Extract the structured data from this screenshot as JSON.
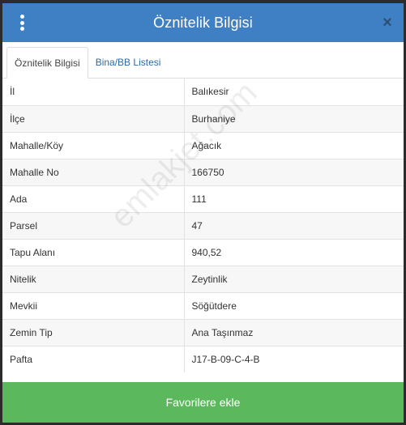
{
  "header": {
    "title": "Öznitelik Bilgisi",
    "menu_icon": "kebab-menu-icon",
    "close_label": "×"
  },
  "tabs": [
    {
      "label": "Öznitelik Bilgisi",
      "active": true
    },
    {
      "label": "Bina/BB Listesi",
      "active": false
    }
  ],
  "rows": [
    {
      "key": "İl",
      "value": "Balıkesir"
    },
    {
      "key": "İlçe",
      "value": "Burhaniye"
    },
    {
      "key": "Mahalle/Köy",
      "value": "Ağacık"
    },
    {
      "key": "Mahalle No",
      "value": "166750"
    },
    {
      "key": "Ada",
      "value": "111"
    },
    {
      "key": "Parsel",
      "value": "47"
    },
    {
      "key": "Tapu Alanı",
      "value": "940,52"
    },
    {
      "key": "Nitelik",
      "value": "Zeytinlik"
    },
    {
      "key": "Mevkii",
      "value": "Söğütdere"
    },
    {
      "key": "Zemin Tip",
      "value": "Ana Taşınmaz"
    },
    {
      "key": "Pafta",
      "value": "J17-B-09-C-4-B"
    }
  ],
  "footer": {
    "button_label": "Favorilere ekle"
  },
  "watermark": "emlakjet.com",
  "colors": {
    "header": "#3f7fc4",
    "button": "#5cb85c",
    "tab_link": "#2c6aa8"
  }
}
